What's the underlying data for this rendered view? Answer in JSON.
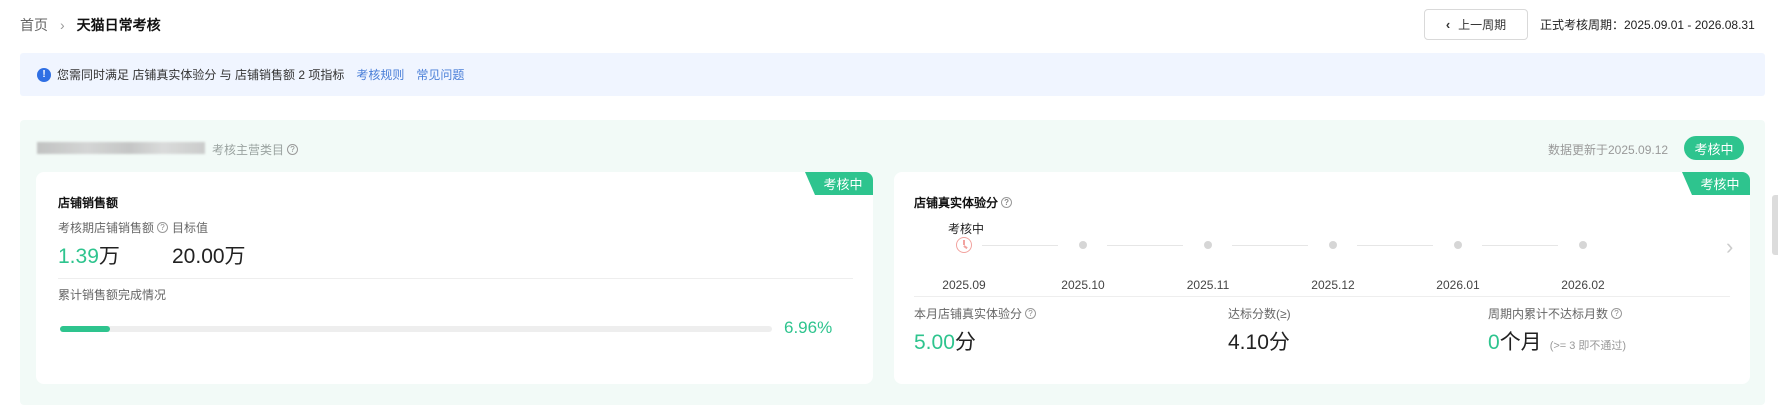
{
  "breadcrumb": {
    "home": "首页",
    "separator": "›",
    "current": "天猫日常考核"
  },
  "header": {
    "prev_button": "上一周期",
    "period_text": "正式考核周期：2025.09.01 - 2026.08.31"
  },
  "notice": {
    "text": "您需同时满足 店铺真实体验分 与 店铺销售额 2 项指标",
    "links": [
      "考核规则",
      "常见问题"
    ]
  },
  "panel": {
    "category_label": "考核主营类目",
    "updated_text": "数据更新于2025.09.12",
    "status": "考核中"
  },
  "sales_card": {
    "tag": "考核中",
    "title": "店铺销售额",
    "period_sales_label": "考核期店铺销售额",
    "period_sales_value": "1.39",
    "period_sales_unit": "万",
    "target_label": "目标值",
    "target_value": "20.00万",
    "progress_label": "累计销售额完成情况",
    "progress_percent": 6.96,
    "progress_text": "6.96%"
  },
  "experience_card": {
    "tag": "考核中",
    "title": "店铺真实体验分",
    "timeline_status": "考核中",
    "timeline_months": [
      "2025.09",
      "2025.10",
      "2025.11",
      "2025.12",
      "2026.01",
      "2026.02"
    ],
    "month_score_label": "本月店铺真实体验分",
    "month_score_value": "5.00",
    "month_score_unit": "分",
    "target_score_label": "达标分数(≥)",
    "target_score_value": "4.10分",
    "fail_months_label": "周期内累计不达标月数",
    "fail_months_value": "0",
    "fail_months_unit": "个月",
    "fail_months_note": "(>= 3 即不通过)"
  },
  "colors": {
    "accent": "#2ec48e",
    "link": "#4a7fd8",
    "info": "#2f6fe4",
    "notice_bg": "#f0f5ff",
    "panel_bg": "#f2faf7"
  }
}
